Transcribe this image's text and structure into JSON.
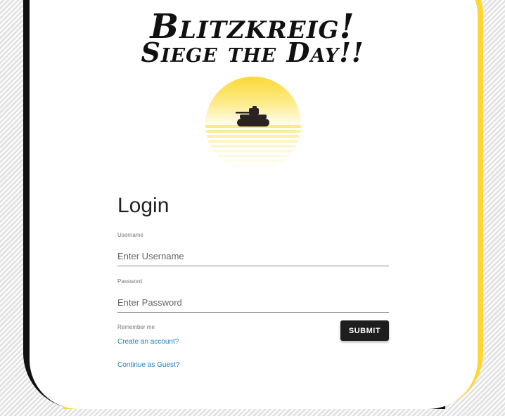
{
  "header": {
    "title_line1": "Blitzkreig!",
    "title_line2": "Siege the Day!!"
  },
  "logo": {
    "icon": "tank-sunset-logo",
    "sun_color": "#fdd835"
  },
  "login": {
    "heading": "Login",
    "username_label": "Username",
    "username_placeholder": "Enter Username",
    "password_label": "Password",
    "password_placeholder": "Enter Password",
    "remember_label": "Remember me",
    "submit_label": "SUBMIT",
    "create_account_link": "Create an account?",
    "guest_link": "Continue as Guest?"
  },
  "colors": {
    "accent": "#fdd835",
    "link": "#1a7fc4",
    "button": "#1e1e1e"
  }
}
